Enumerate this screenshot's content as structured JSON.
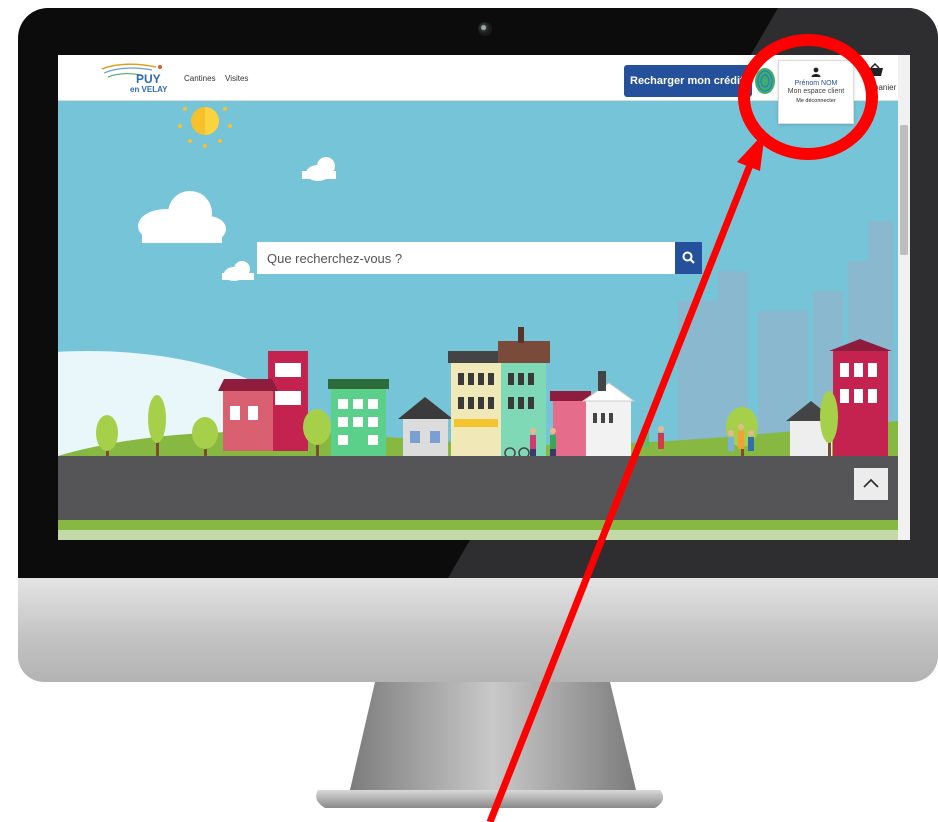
{
  "site": {
    "logo_text_top": "PUY",
    "logo_text_bottom": "en VELAY",
    "nav": [
      {
        "label": "Cantines"
      },
      {
        "label": "Visites"
      }
    ],
    "recharge_label": "Recharger mon crédit ›",
    "account": {
      "name": "Prénom NOM",
      "space": "Mon espace client",
      "logout": "Me déconnecter"
    },
    "cart_label": "panier",
    "search_placeholder": "Que recherchez-vous ?"
  },
  "icons": {
    "search": "search-icon",
    "user": "user-icon",
    "cart": "basket-icon",
    "up": "chevron-up-icon",
    "fingerprint": "fingerprint-icon"
  },
  "colors": {
    "brand_blue": "#25519c",
    "sky": "#76c4d8",
    "road": "#555558",
    "grass": "#86b842",
    "annotation_red": "#ff0000"
  }
}
